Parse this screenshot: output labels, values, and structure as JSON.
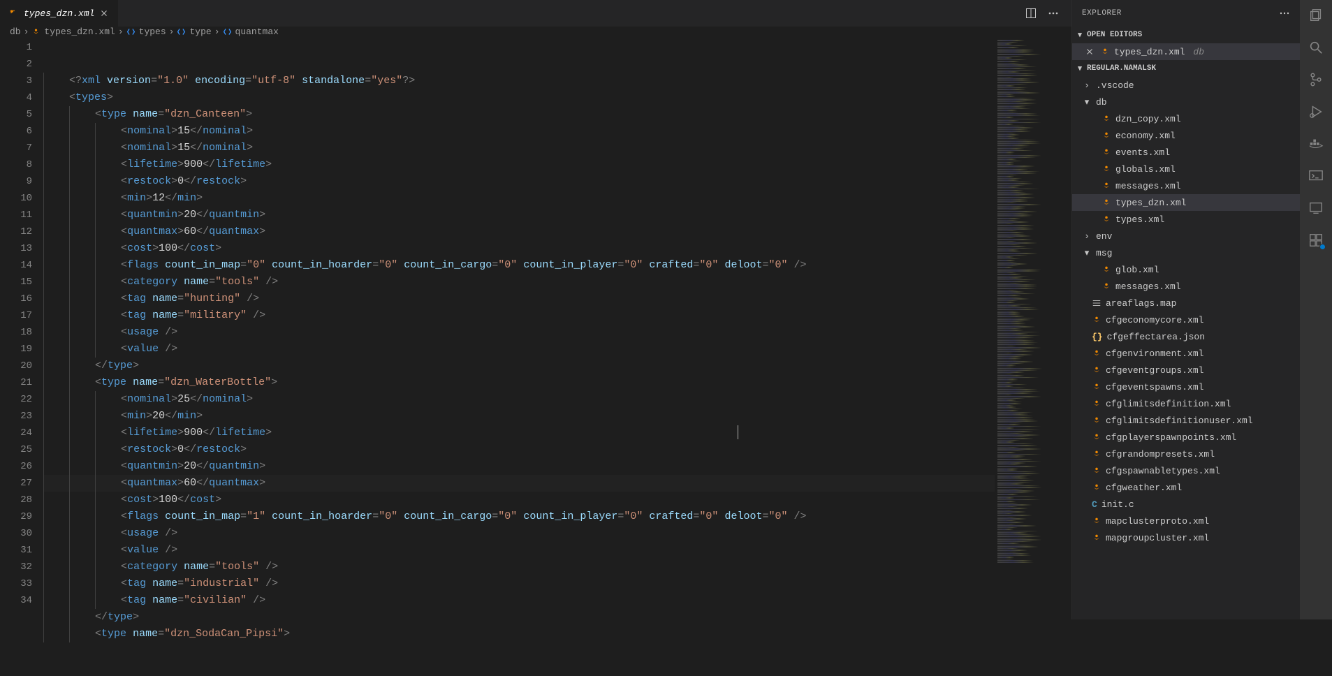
{
  "tab": {
    "label": "types_dzn.xml"
  },
  "tab_actions": {
    "split": "split-editor",
    "more": "more"
  },
  "breadcrumb": [
    {
      "label": "db",
      "icon": ""
    },
    {
      "label": "types_dzn.xml",
      "icon": "xml"
    },
    {
      "label": "types",
      "icon": "el"
    },
    {
      "label": "type",
      "icon": "el"
    },
    {
      "label": "quantmax",
      "icon": "el"
    }
  ],
  "code": [
    {
      "n": 1,
      "i": 0,
      "t": [
        [
          "p",
          "<?"
        ],
        [
          "t",
          "xml "
        ],
        [
          "a",
          "version"
        ],
        [
          "p",
          "="
        ],
        [
          "s",
          "\"1.0\""
        ],
        [
          "p",
          " "
        ],
        [
          "a",
          "encoding"
        ],
        [
          "p",
          "="
        ],
        [
          "s",
          "\"utf-8\""
        ],
        [
          "p",
          " "
        ],
        [
          "a",
          "standalone"
        ],
        [
          "p",
          "="
        ],
        [
          "s",
          "\"yes\""
        ],
        [
          "p",
          "?>"
        ]
      ]
    },
    {
      "n": 2,
      "i": 0,
      "t": [
        [
          "p",
          "<"
        ],
        [
          "t",
          "types"
        ],
        [
          "p",
          ">"
        ]
      ]
    },
    {
      "n": 3,
      "i": 1,
      "t": [
        [
          "p",
          "<"
        ],
        [
          "t",
          "type "
        ],
        [
          "a",
          "name"
        ],
        [
          "p",
          "="
        ],
        [
          "s",
          "\"dzn_Canteen\""
        ],
        [
          "p",
          ">"
        ]
      ]
    },
    {
      "n": 4,
      "i": 2,
      "t": [
        [
          "p",
          "<"
        ],
        [
          "t",
          "nominal"
        ],
        [
          "p",
          ">"
        ],
        [
          "x",
          "15"
        ],
        [
          "p",
          "</"
        ],
        [
          "t",
          "nominal"
        ],
        [
          "p",
          ">"
        ]
      ]
    },
    {
      "n": 5,
      "i": 2,
      "t": [
        [
          "p",
          "<"
        ],
        [
          "t",
          "nominal"
        ],
        [
          "p",
          ">"
        ],
        [
          "x",
          "15"
        ],
        [
          "p",
          "</"
        ],
        [
          "t",
          "nominal"
        ],
        [
          "p",
          ">"
        ]
      ]
    },
    {
      "n": 6,
      "i": 2,
      "t": [
        [
          "p",
          "<"
        ],
        [
          "t",
          "lifetime"
        ],
        [
          "p",
          ">"
        ],
        [
          "x",
          "900"
        ],
        [
          "p",
          "</"
        ],
        [
          "t",
          "lifetime"
        ],
        [
          "p",
          ">"
        ]
      ]
    },
    {
      "n": 7,
      "i": 2,
      "t": [
        [
          "p",
          "<"
        ],
        [
          "t",
          "restock"
        ],
        [
          "p",
          ">"
        ],
        [
          "x",
          "0"
        ],
        [
          "p",
          "</"
        ],
        [
          "t",
          "restock"
        ],
        [
          "p",
          ">"
        ]
      ]
    },
    {
      "n": 8,
      "i": 2,
      "t": [
        [
          "p",
          "<"
        ],
        [
          "t",
          "min"
        ],
        [
          "p",
          ">"
        ],
        [
          "x",
          "12"
        ],
        [
          "p",
          "</"
        ],
        [
          "t",
          "min"
        ],
        [
          "p",
          ">"
        ]
      ]
    },
    {
      "n": 9,
      "i": 2,
      "t": [
        [
          "p",
          "<"
        ],
        [
          "t",
          "quantmin"
        ],
        [
          "p",
          ">"
        ],
        [
          "x",
          "20"
        ],
        [
          "p",
          "</"
        ],
        [
          "t",
          "quantmin"
        ],
        [
          "p",
          ">"
        ]
      ]
    },
    {
      "n": 10,
      "i": 2,
      "t": [
        [
          "p",
          "<"
        ],
        [
          "t",
          "quantmax"
        ],
        [
          "p",
          ">"
        ],
        [
          "x",
          "60"
        ],
        [
          "p",
          "</"
        ],
        [
          "t",
          "quantmax"
        ],
        [
          "p",
          ">"
        ]
      ]
    },
    {
      "n": 11,
      "i": 2,
      "t": [
        [
          "p",
          "<"
        ],
        [
          "t",
          "cost"
        ],
        [
          "p",
          ">"
        ],
        [
          "x",
          "100"
        ],
        [
          "p",
          "</"
        ],
        [
          "t",
          "cost"
        ],
        [
          "p",
          ">"
        ]
      ]
    },
    {
      "n": 12,
      "i": 2,
      "t": [
        [
          "p",
          "<"
        ],
        [
          "t",
          "flags "
        ],
        [
          "a",
          "count_in_map"
        ],
        [
          "p",
          "="
        ],
        [
          "s",
          "\"0\""
        ],
        [
          "p",
          " "
        ],
        [
          "a",
          "count_in_hoarder"
        ],
        [
          "p",
          "="
        ],
        [
          "s",
          "\"0\""
        ],
        [
          "p",
          " "
        ],
        [
          "a",
          "count_in_cargo"
        ],
        [
          "p",
          "="
        ],
        [
          "s",
          "\"0\""
        ],
        [
          "p",
          " "
        ],
        [
          "a",
          "count_in_player"
        ],
        [
          "p",
          "="
        ],
        [
          "s",
          "\"0\""
        ],
        [
          "p",
          " "
        ],
        [
          "a",
          "crafted"
        ],
        [
          "p",
          "="
        ],
        [
          "s",
          "\"0\""
        ],
        [
          "p",
          " "
        ],
        [
          "a",
          "deloot"
        ],
        [
          "p",
          "="
        ],
        [
          "s",
          "\"0\""
        ],
        [
          "p",
          " />"
        ]
      ]
    },
    {
      "n": 13,
      "i": 2,
      "t": [
        [
          "p",
          "<"
        ],
        [
          "t",
          "category "
        ],
        [
          "a",
          "name"
        ],
        [
          "p",
          "="
        ],
        [
          "s",
          "\"tools\""
        ],
        [
          "p",
          " />"
        ]
      ]
    },
    {
      "n": 14,
      "i": 2,
      "t": [
        [
          "p",
          "<"
        ],
        [
          "t",
          "tag "
        ],
        [
          "a",
          "name"
        ],
        [
          "p",
          "="
        ],
        [
          "s",
          "\"hunting\""
        ],
        [
          "p",
          " />"
        ]
      ]
    },
    {
      "n": 15,
      "i": 2,
      "t": [
        [
          "p",
          "<"
        ],
        [
          "t",
          "tag "
        ],
        [
          "a",
          "name"
        ],
        [
          "p",
          "="
        ],
        [
          "s",
          "\"military\""
        ],
        [
          "p",
          " />"
        ]
      ]
    },
    {
      "n": 16,
      "i": 2,
      "t": [
        [
          "p",
          "<"
        ],
        [
          "t",
          "usage "
        ],
        [
          "p",
          "/>"
        ]
      ]
    },
    {
      "n": 17,
      "i": 2,
      "t": [
        [
          "p",
          "<"
        ],
        [
          "t",
          "value "
        ],
        [
          "p",
          "/>"
        ]
      ]
    },
    {
      "n": 18,
      "i": 1,
      "t": [
        [
          "p",
          "</"
        ],
        [
          "t",
          "type"
        ],
        [
          "p",
          ">"
        ]
      ]
    },
    {
      "n": 19,
      "i": 1,
      "t": [
        [
          "p",
          "<"
        ],
        [
          "t",
          "type "
        ],
        [
          "a",
          "name"
        ],
        [
          "p",
          "="
        ],
        [
          "s",
          "\"dzn_WaterBottle\""
        ],
        [
          "p",
          ">"
        ]
      ]
    },
    {
      "n": 20,
      "i": 2,
      "t": [
        [
          "p",
          "<"
        ],
        [
          "t",
          "nominal"
        ],
        [
          "p",
          ">"
        ],
        [
          "x",
          "25"
        ],
        [
          "p",
          "</"
        ],
        [
          "t",
          "nominal"
        ],
        [
          "p",
          ">"
        ]
      ]
    },
    {
      "n": 21,
      "i": 2,
      "t": [
        [
          "p",
          "<"
        ],
        [
          "t",
          "min"
        ],
        [
          "p",
          ">"
        ],
        [
          "x",
          "20"
        ],
        [
          "p",
          "</"
        ],
        [
          "t",
          "min"
        ],
        [
          "p",
          ">"
        ]
      ]
    },
    {
      "n": 22,
      "i": 2,
      "t": [
        [
          "p",
          "<"
        ],
        [
          "t",
          "lifetime"
        ],
        [
          "p",
          ">"
        ],
        [
          "x",
          "900"
        ],
        [
          "p",
          "</"
        ],
        [
          "t",
          "lifetime"
        ],
        [
          "p",
          ">"
        ]
      ]
    },
    {
      "n": 23,
      "i": 2,
      "t": [
        [
          "p",
          "<"
        ],
        [
          "t",
          "restock"
        ],
        [
          "p",
          ">"
        ],
        [
          "x",
          "0"
        ],
        [
          "p",
          "</"
        ],
        [
          "t",
          "restock"
        ],
        [
          "p",
          ">"
        ]
      ]
    },
    {
      "n": 24,
      "i": 2,
      "t": [
        [
          "p",
          "<"
        ],
        [
          "t",
          "quantmin"
        ],
        [
          "p",
          ">"
        ],
        [
          "x",
          "20"
        ],
        [
          "p",
          "</"
        ],
        [
          "t",
          "quantmin"
        ],
        [
          "p",
          ">"
        ]
      ]
    },
    {
      "n": 25,
      "i": 2,
      "hl": true,
      "t": [
        [
          "p",
          "<"
        ],
        [
          "t",
          "quantmax"
        ],
        [
          "p",
          ">"
        ],
        [
          "x",
          "60"
        ],
        [
          "p",
          "</"
        ],
        [
          "t",
          "quantmax"
        ],
        [
          "p",
          ">"
        ]
      ]
    },
    {
      "n": 26,
      "i": 2,
      "t": [
        [
          "p",
          "<"
        ],
        [
          "t",
          "cost"
        ],
        [
          "p",
          ">"
        ],
        [
          "x",
          "100"
        ],
        [
          "p",
          "</"
        ],
        [
          "t",
          "cost"
        ],
        [
          "p",
          ">"
        ]
      ]
    },
    {
      "n": 27,
      "i": 2,
      "t": [
        [
          "p",
          "<"
        ],
        [
          "t",
          "flags "
        ],
        [
          "a",
          "count_in_map"
        ],
        [
          "p",
          "="
        ],
        [
          "s",
          "\"1\""
        ],
        [
          "p",
          " "
        ],
        [
          "a",
          "count_in_hoarder"
        ],
        [
          "p",
          "="
        ],
        [
          "s",
          "\"0\""
        ],
        [
          "p",
          " "
        ],
        [
          "a",
          "count_in_cargo"
        ],
        [
          "p",
          "="
        ],
        [
          "s",
          "\"0\""
        ],
        [
          "p",
          " "
        ],
        [
          "a",
          "count_in_player"
        ],
        [
          "p",
          "="
        ],
        [
          "s",
          "\"0\""
        ],
        [
          "p",
          " "
        ],
        [
          "a",
          "crafted"
        ],
        [
          "p",
          "="
        ],
        [
          "s",
          "\"0\""
        ],
        [
          "p",
          " "
        ],
        [
          "a",
          "deloot"
        ],
        [
          "p",
          "="
        ],
        [
          "s",
          "\"0\""
        ],
        [
          "p",
          " />"
        ]
      ]
    },
    {
      "n": 28,
      "i": 2,
      "t": [
        [
          "p",
          "<"
        ],
        [
          "t",
          "usage "
        ],
        [
          "p",
          "/>"
        ]
      ]
    },
    {
      "n": 29,
      "i": 2,
      "t": [
        [
          "p",
          "<"
        ],
        [
          "t",
          "value "
        ],
        [
          "p",
          "/>"
        ]
      ]
    },
    {
      "n": 30,
      "i": 2,
      "t": [
        [
          "p",
          "<"
        ],
        [
          "t",
          "category "
        ],
        [
          "a",
          "name"
        ],
        [
          "p",
          "="
        ],
        [
          "s",
          "\"tools\""
        ],
        [
          "p",
          " />"
        ]
      ]
    },
    {
      "n": 31,
      "i": 2,
      "t": [
        [
          "p",
          "<"
        ],
        [
          "t",
          "tag "
        ],
        [
          "a",
          "name"
        ],
        [
          "p",
          "="
        ],
        [
          "s",
          "\"industrial\""
        ],
        [
          "p",
          " />"
        ]
      ]
    },
    {
      "n": 32,
      "i": 2,
      "t": [
        [
          "p",
          "<"
        ],
        [
          "t",
          "tag "
        ],
        [
          "a",
          "name"
        ],
        [
          "p",
          "="
        ],
        [
          "s",
          "\"civilian\""
        ],
        [
          "p",
          " />"
        ]
      ]
    },
    {
      "n": 33,
      "i": 1,
      "t": [
        [
          "p",
          "</"
        ],
        [
          "t",
          "type"
        ],
        [
          "p",
          ">"
        ]
      ]
    },
    {
      "n": 34,
      "i": 1,
      "t": [
        [
          "p",
          "<"
        ],
        [
          "t",
          "type "
        ],
        [
          "a",
          "name"
        ],
        [
          "p",
          "="
        ],
        [
          "s",
          "\"dzn_SodaCan_Pipsi\""
        ],
        [
          "p",
          ">"
        ]
      ]
    }
  ],
  "explorer": {
    "title": "EXPLORER",
    "sections": {
      "open_editors": "OPEN EDITORS",
      "workspace": "REGULAR.NAMALSK"
    },
    "open_editor": {
      "label": "types_dzn.xml",
      "desc": "db"
    },
    "tree": [
      {
        "type": "folder",
        "label": ".vscode",
        "open": false,
        "depth": 0
      },
      {
        "type": "folder",
        "label": "db",
        "open": true,
        "depth": 0
      },
      {
        "type": "file",
        "icon": "xml",
        "label": "dzn_copy.xml",
        "depth": 1
      },
      {
        "type": "file",
        "icon": "xml",
        "label": "economy.xml",
        "depth": 1
      },
      {
        "type": "file",
        "icon": "xml",
        "label": "events.xml",
        "depth": 1
      },
      {
        "type": "file",
        "icon": "xml",
        "label": "globals.xml",
        "depth": 1
      },
      {
        "type": "file",
        "icon": "xml",
        "label": "messages.xml",
        "depth": 1
      },
      {
        "type": "file",
        "icon": "xml",
        "label": "types_dzn.xml",
        "depth": 1,
        "selected": true
      },
      {
        "type": "file",
        "icon": "xml",
        "label": "types.xml",
        "depth": 1
      },
      {
        "type": "folder",
        "label": "env",
        "open": false,
        "depth": 0
      },
      {
        "type": "folder",
        "label": "msg",
        "open": true,
        "depth": 0
      },
      {
        "type": "file",
        "icon": "xml",
        "label": "glob.xml",
        "depth": 1
      },
      {
        "type": "file",
        "icon": "xml",
        "label": "messages.xml",
        "depth": 1
      },
      {
        "type": "file",
        "icon": "map",
        "label": "areaflags.map",
        "depth": 0
      },
      {
        "type": "file",
        "icon": "xml",
        "label": "cfgeconomycore.xml",
        "depth": 0
      },
      {
        "type": "file",
        "icon": "json",
        "label": "cfgeffectarea.json",
        "depth": 0
      },
      {
        "type": "file",
        "icon": "xml",
        "label": "cfgenvironment.xml",
        "depth": 0
      },
      {
        "type": "file",
        "icon": "xml",
        "label": "cfgeventgroups.xml",
        "depth": 0
      },
      {
        "type": "file",
        "icon": "xml",
        "label": "cfgeventspawns.xml",
        "depth": 0
      },
      {
        "type": "file",
        "icon": "xml",
        "label": "cfglimitsdefinition.xml",
        "depth": 0
      },
      {
        "type": "file",
        "icon": "xml",
        "label": "cfglimitsdefinitionuser.xml",
        "depth": 0
      },
      {
        "type": "file",
        "icon": "xml",
        "label": "cfgplayerspawnpoints.xml",
        "depth": 0
      },
      {
        "type": "file",
        "icon": "xml",
        "label": "cfgrandompresets.xml",
        "depth": 0
      },
      {
        "type": "file",
        "icon": "xml",
        "label": "cfgspawnabletypes.xml",
        "depth": 0
      },
      {
        "type": "file",
        "icon": "xml",
        "label": "cfgweather.xml",
        "depth": 0
      },
      {
        "type": "file",
        "icon": "c",
        "label": "init.c",
        "depth": 0
      },
      {
        "type": "file",
        "icon": "xml",
        "label": "mapclusterproto.xml",
        "depth": 0
      },
      {
        "type": "file",
        "icon": "xml",
        "label": "mapgroupcluster.xml",
        "depth": 0
      }
    ]
  }
}
